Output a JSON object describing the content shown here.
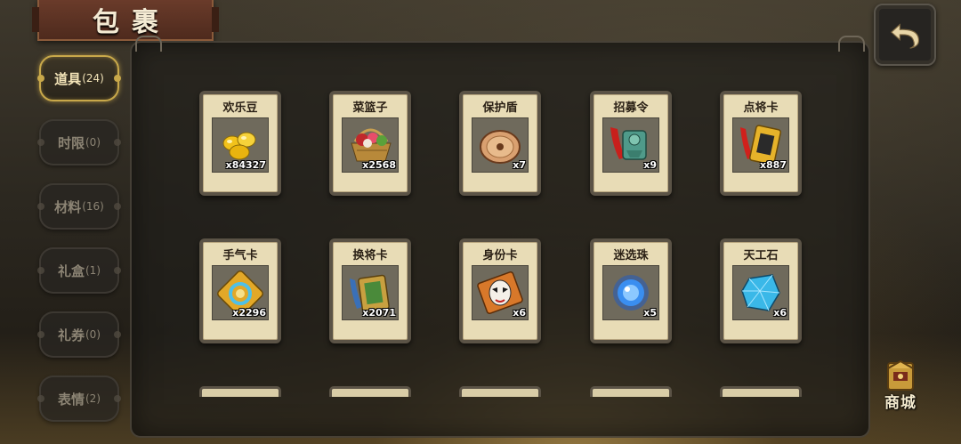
{
  "header": {
    "title": "包裹"
  },
  "tabs": [
    {
      "label": "道具",
      "count": "(24)",
      "active": true
    },
    {
      "label": "时限",
      "count": "(0)",
      "active": false
    },
    {
      "label": "材料",
      "count": "(16)",
      "active": false
    },
    {
      "label": "礼盒",
      "count": "(1)",
      "active": false
    },
    {
      "label": "礼券",
      "count": "(0)",
      "active": false
    },
    {
      "label": "表情",
      "count": "(2)",
      "active": false
    }
  ],
  "items": [
    {
      "name": "欢乐豆",
      "qty": "x84327",
      "icon": "gold-beans-icon"
    },
    {
      "name": "菜篮子",
      "qty": "x2568",
      "icon": "vegetable-basket-icon"
    },
    {
      "name": "保护盾",
      "qty": "x7",
      "icon": "shield-icon"
    },
    {
      "name": "招募令",
      "qty": "x9",
      "icon": "recruit-token-icon"
    },
    {
      "name": "点将卡",
      "qty": "x887",
      "icon": "general-card-icon"
    },
    {
      "name": "手气卡",
      "qty": "x2296",
      "icon": "luck-card-icon"
    },
    {
      "name": "换将卡",
      "qty": "x2071",
      "icon": "swap-general-card-icon"
    },
    {
      "name": "身份卡",
      "qty": "x6",
      "icon": "identity-card-icon"
    },
    {
      "name": "迷选珠",
      "qty": "x5",
      "icon": "blue-orb-icon"
    },
    {
      "name": "天工石",
      "qty": "x6",
      "icon": "blue-gem-icon"
    }
  ],
  "shop": {
    "label": "商城"
  },
  "colors": {
    "accent_gold": "#c8a84a",
    "card_bg": "#e8dcb6",
    "title_red": "#6a3b2a"
  }
}
